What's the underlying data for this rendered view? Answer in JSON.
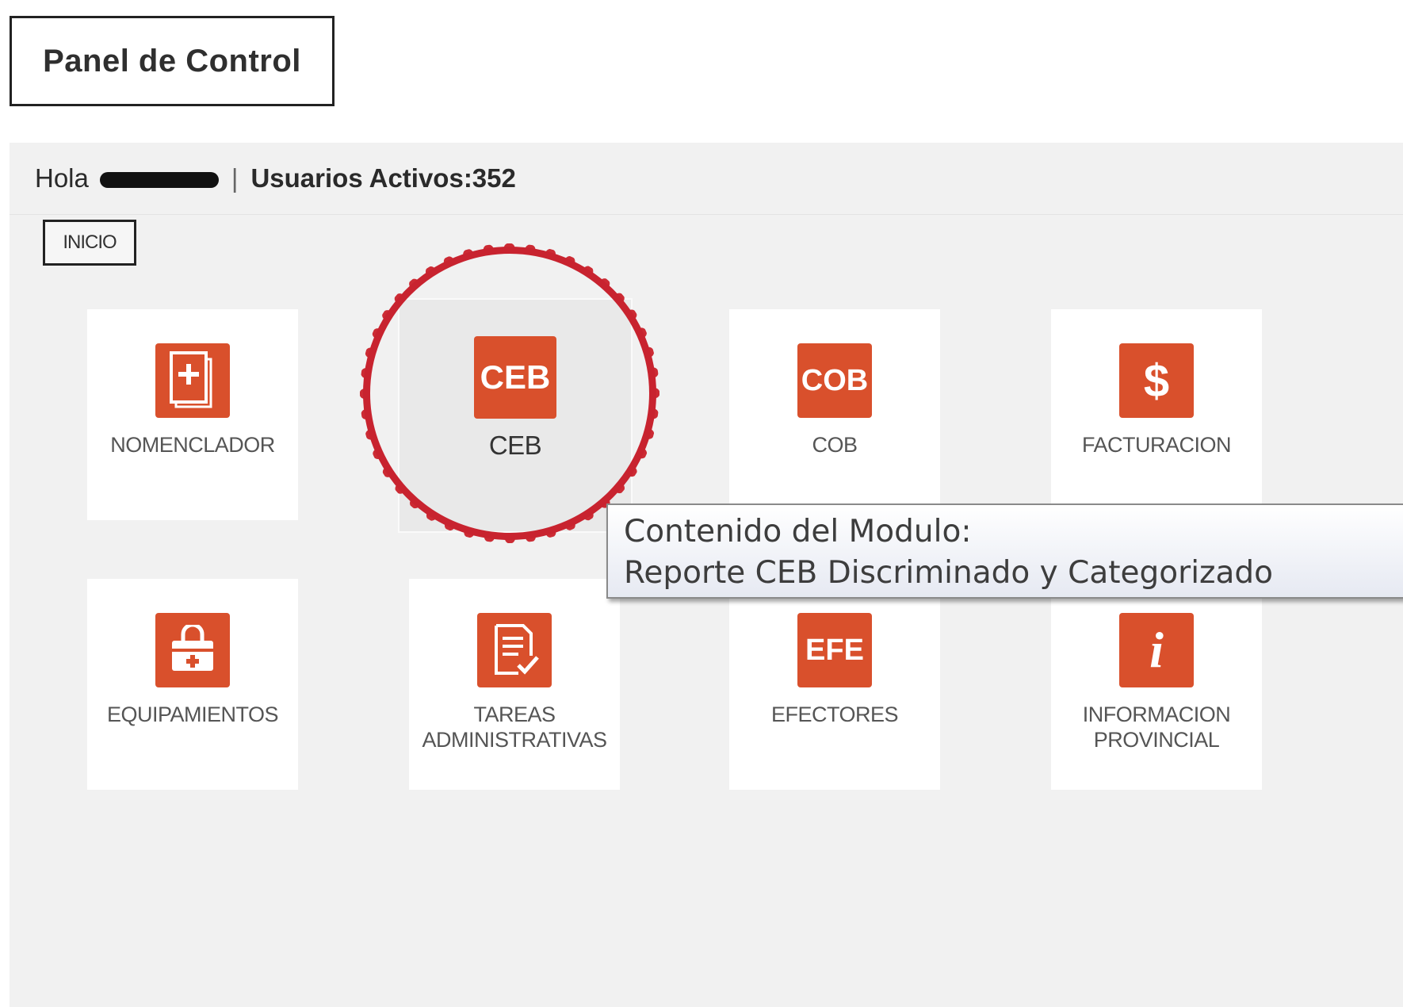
{
  "header": {
    "title": "Panel de Control"
  },
  "topbar": {
    "greeting": "Hola",
    "separator": "|",
    "active_users": "Usuarios Activos:352"
  },
  "breadcrumb": {
    "inicio": "INICIO"
  },
  "colors": {
    "accent": "#d9502c",
    "highlight": "#cc2b34",
    "panel_bg": "#f1f1f1"
  },
  "modules": {
    "nomenclador": {
      "label": "NOMENCLADOR",
      "icon": "medical-folder-icon"
    },
    "ceb": {
      "label": "CEB",
      "icon_text": "CEB"
    },
    "cob": {
      "label": "COB",
      "icon_text": "COB"
    },
    "facturacion": {
      "label": "FACTURACION",
      "icon_text": "$"
    },
    "equipamientos": {
      "label": "EQUIPAMIENTOS",
      "icon": "medical-bag-icon"
    },
    "tareas": {
      "label_line1": "TAREAS",
      "label_line2": "ADMINISTRATIVAS",
      "icon": "task-document-icon"
    },
    "efectores": {
      "label": "EFECTORES",
      "icon_text": "EFE"
    },
    "informacion": {
      "label_line1": "INFORMACION",
      "label_line2": "PROVINCIAL",
      "icon_text": "i"
    }
  },
  "tooltip": {
    "line1": "Contenido del Modulo:",
    "line2": "Reporte CEB Discriminado y Categorizado"
  }
}
